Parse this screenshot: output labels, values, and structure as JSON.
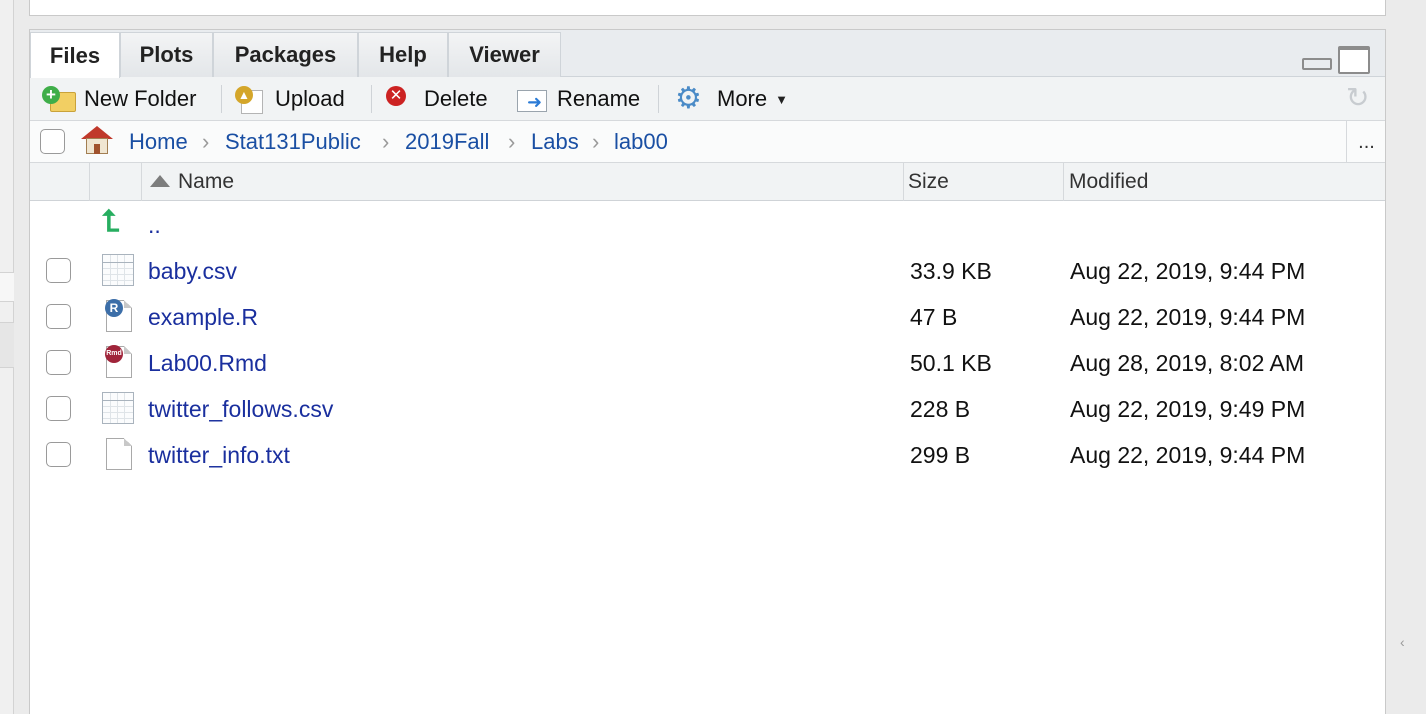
{
  "tabs": [
    {
      "label": "Files",
      "active": true
    },
    {
      "label": "Plots",
      "active": false
    },
    {
      "label": "Packages",
      "active": false
    },
    {
      "label": "Help",
      "active": false
    },
    {
      "label": "Viewer",
      "active": false
    }
  ],
  "toolbar": {
    "new_folder": "New Folder",
    "upload": "Upload",
    "delete": "Delete",
    "rename": "Rename",
    "more": "More"
  },
  "path": {
    "crumbs": [
      "Home",
      "Stat131Public",
      "2019Fall",
      "Labs",
      "lab00"
    ],
    "more": "..."
  },
  "columns": {
    "name": "Name",
    "size": "Size",
    "modified": "Modified"
  },
  "parent_link": "..",
  "files": [
    {
      "name": "baby.csv",
      "size": "33.9 KB",
      "modified": "Aug 22, 2019, 9:44 PM",
      "icon": "csv-icon"
    },
    {
      "name": "example.R",
      "size": "47 B",
      "modified": "Aug 22, 2019, 9:44 PM",
      "icon": "r-file-icon"
    },
    {
      "name": "Lab00.Rmd",
      "size": "50.1 KB",
      "modified": "Aug 28, 2019, 8:02 AM",
      "icon": "rmd-file-icon"
    },
    {
      "name": "twitter_follows.csv",
      "size": "228 B",
      "modified": "Aug 22, 2019, 9:49 PM",
      "icon": "csv-icon"
    },
    {
      "name": "twitter_info.txt",
      "size": "299 B",
      "modified": "Aug 22, 2019, 9:44 PM",
      "icon": "text-file-icon"
    }
  ],
  "icons": {
    "r_badge": "R",
    "rmd_badge": "Rmd"
  },
  "colors": {
    "link": "#1a2f9e",
    "crumb": "#1a4fa3"
  }
}
